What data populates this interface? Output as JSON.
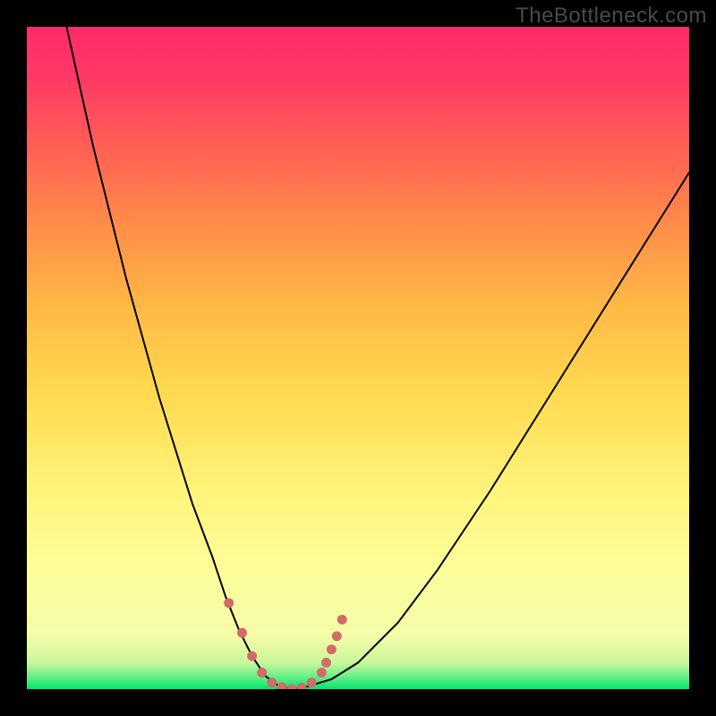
{
  "watermark": "TheBottleneck.com",
  "chart_data": {
    "type": "line",
    "title": "",
    "xlabel": "",
    "ylabel": "",
    "xlim": [
      0,
      100
    ],
    "ylim": [
      0,
      100
    ],
    "legend": false,
    "grid": false,
    "background_gradient": {
      "direction": "vertical",
      "stops": [
        {
          "pos": 0,
          "color": "#00e66a"
        },
        {
          "pos": 2,
          "color": "#6cf08a"
        },
        {
          "pos": 4,
          "color": "#c9f79a"
        },
        {
          "pos": 8,
          "color": "#f5fca8"
        },
        {
          "pos": 18,
          "color": "#fdfd9a"
        },
        {
          "pos": 30,
          "color": "#fef47a"
        },
        {
          "pos": 45,
          "color": "#ffd94f"
        },
        {
          "pos": 58,
          "color": "#ffb846"
        },
        {
          "pos": 70,
          "color": "#ff8d49"
        },
        {
          "pos": 82,
          "color": "#ff5f55"
        },
        {
          "pos": 92,
          "color": "#ff3a64"
        },
        {
          "pos": 100,
          "color": "#ff2a6a"
        }
      ]
    },
    "series": [
      {
        "name": "curve",
        "color": "#000000",
        "stroke_width": 2,
        "x": [
          6,
          10,
          15,
          20,
          25,
          28,
          30,
          32,
          34,
          36,
          38,
          40,
          42,
          46,
          50,
          56,
          62,
          70,
          80,
          90,
          100
        ],
        "y": [
          100,
          82,
          62,
          44,
          28,
          20,
          14,
          9,
          5,
          2,
          0.5,
          0,
          0.3,
          1.5,
          4,
          10,
          18,
          30,
          46,
          62,
          78
        ]
      }
    ],
    "annotations": [
      {
        "name": "valley-marker",
        "type": "scatter",
        "color": "#d46a6a",
        "marker_size": 11,
        "x": [
          30.5,
          32.5,
          34,
          35.5,
          37,
          38.5,
          40,
          41.5,
          43,
          44.5,
          45.2,
          46,
          46.8,
          47.6
        ],
        "y": [
          13,
          8.5,
          5,
          2.5,
          1,
          0.3,
          0,
          0.2,
          1,
          2.5,
          4,
          6,
          8,
          10.5
        ]
      }
    ]
  }
}
